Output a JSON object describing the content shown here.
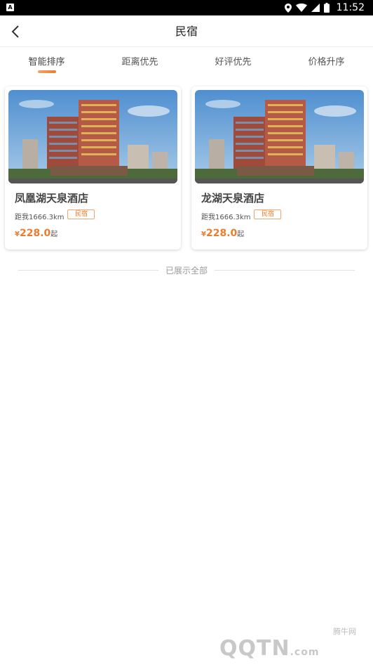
{
  "status_bar": {
    "app_badge": "A",
    "time": "11:52"
  },
  "header": {
    "title": "民宿"
  },
  "tabs": [
    {
      "label": "智能排序",
      "active": true
    },
    {
      "label": "距离优先",
      "active": false
    },
    {
      "label": "好评优先",
      "active": false
    },
    {
      "label": "价格升序",
      "active": false
    }
  ],
  "hotels": [
    {
      "name": "凤凰湖天泉酒店",
      "distance": "距我1666.3km",
      "tag": "民宿",
      "currency": "¥",
      "price": "228.0",
      "price_suffix": "起"
    },
    {
      "name": "龙湖天泉酒店",
      "distance": "距我1666.3km",
      "tag": "民宿",
      "currency": "¥",
      "price": "228.0",
      "price_suffix": "起"
    }
  ],
  "list_end_text": "已展示全部",
  "watermark": {
    "site_cn": "腾牛网",
    "logo": "QQTN",
    "domain": ".com"
  },
  "colors": {
    "accent": "#ef7b2f",
    "tag_border": "#f0a66c"
  }
}
